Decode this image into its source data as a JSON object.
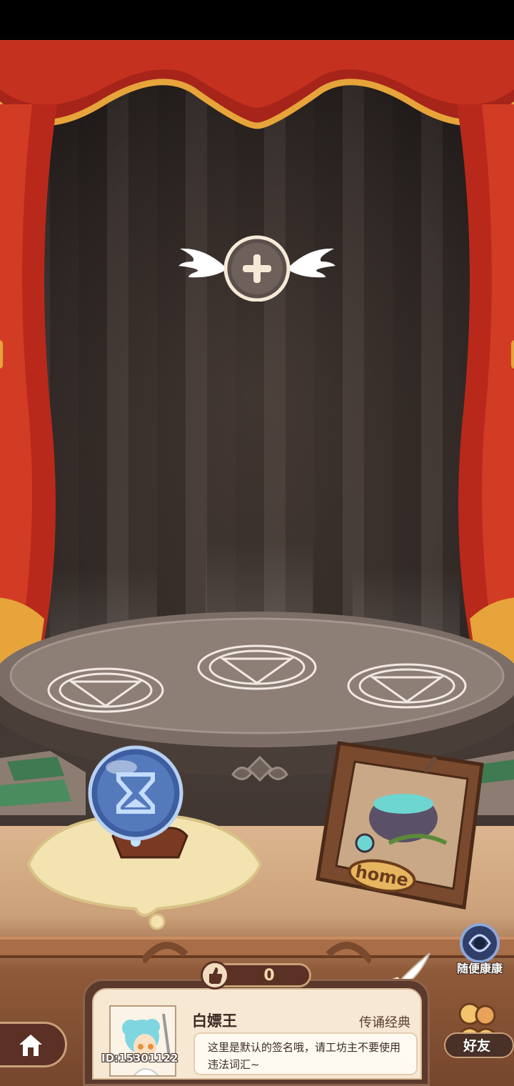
{
  "stage": {
    "add_slot_icon": "plus-icon",
    "frame_sign": "home"
  },
  "side_buttons": {
    "random_visit_label": "随便康康",
    "friends_label": "好友"
  },
  "profile": {
    "likes_count": "0",
    "username": "白嫖王",
    "title": "传诵经典",
    "signature": "这里是默认的签名哦，请工坊主不要使用违法词汇~",
    "user_id": "ID:15301122"
  },
  "colors": {
    "curtain_red": "#b8291b",
    "fringe_gold": "#e6a43a",
    "card_bg": "#f6e8d3",
    "panel_brown": "#5a3124"
  }
}
